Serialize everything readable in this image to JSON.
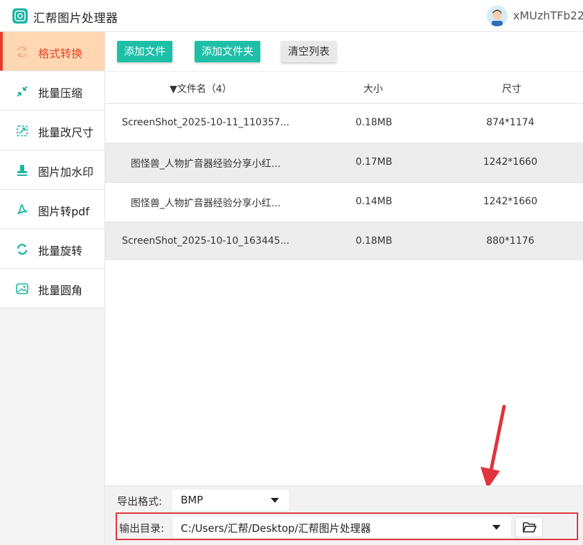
{
  "app": {
    "title": "汇帮图片处理器",
    "user_name": "xMUzhTFb22"
  },
  "colors": {
    "accent": "#1dbfa6",
    "active_bg": "#ffd7b3",
    "active_text": "#e8462c",
    "highlight_red": "#e0333c"
  },
  "sidebar": {
    "items": [
      {
        "label": "格式转换",
        "icon": "format-convert-icon",
        "active": true
      },
      {
        "label": "批量压缩",
        "icon": "compress-icon",
        "active": false
      },
      {
        "label": "批量改尺寸",
        "icon": "resize-icon",
        "active": false
      },
      {
        "label": "图片加水印",
        "icon": "watermark-icon",
        "active": false
      },
      {
        "label": "图片转pdf",
        "icon": "pdf-icon",
        "active": false
      },
      {
        "label": "批量旋转",
        "icon": "rotate-icon",
        "active": false
      },
      {
        "label": "批量圆角",
        "icon": "rounded-corner-icon",
        "active": false
      }
    ]
  },
  "toolbar": {
    "add_file": "添加文件",
    "add_folder": "添加文件夹",
    "clear_list": "清空列表"
  },
  "table": {
    "columns": {
      "name": "▼文件名（4）",
      "size": "大小",
      "dimensions": "尺寸"
    },
    "rows": [
      {
        "name": "ScreenShot_2025-10-11_110357...",
        "size": "0.18MB",
        "dimensions": "874*1174"
      },
      {
        "name": "图怪兽_人物扩音器经验分享小红...",
        "size": "0.17MB",
        "dimensions": "1242*1660"
      },
      {
        "name": "图怪兽_人物扩音器经验分享小红...",
        "size": "0.14MB",
        "dimensions": "1242*1660"
      },
      {
        "name": "ScreenShot_2025-10-10_163445...",
        "size": "0.18MB",
        "dimensions": "880*1176"
      }
    ]
  },
  "export": {
    "format_label": "导出格式:",
    "format_value": "BMP",
    "output_label": "输出目录:",
    "output_value": "C:/Users/汇帮/Desktop/汇帮图片处理器"
  }
}
